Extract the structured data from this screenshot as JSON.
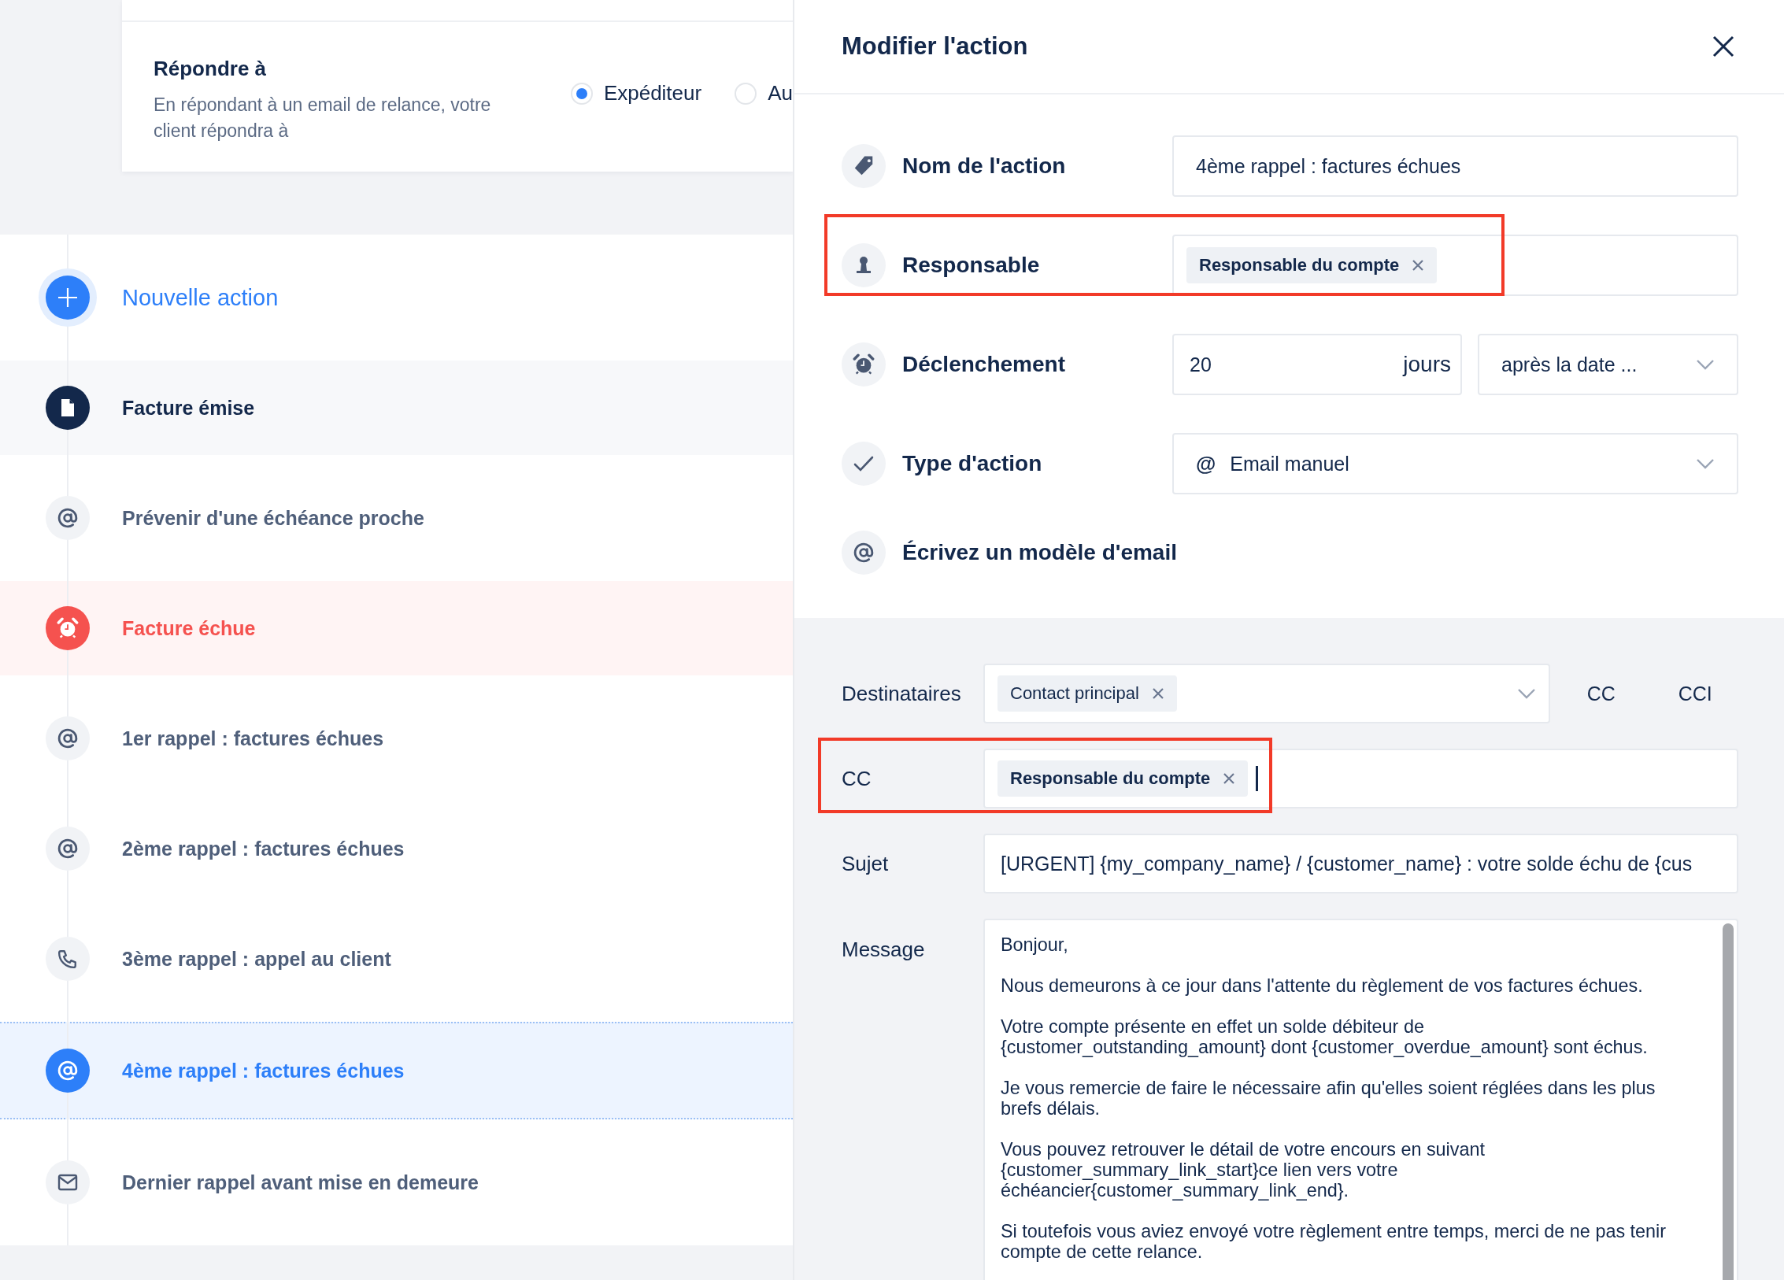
{
  "reply_to": {
    "title": "Répondre à",
    "description": "En répondant à un email de relance, votre client répondra à",
    "options": [
      {
        "label": "Expéditeur",
        "selected": true
      },
      {
        "label": "Au",
        "selected": false
      }
    ]
  },
  "timeline": [
    {
      "kind": "add",
      "label": "Nouvelle action",
      "selected": false
    },
    {
      "kind": "document",
      "color": "#13284b",
      "label": "Facture émise",
      "selected": false
    },
    {
      "kind": "email",
      "label": "Prévenir d'une échéance proche",
      "selected": false
    },
    {
      "kind": "alarm",
      "color": "#f5524f",
      "label": "Facture échue",
      "selected": false
    },
    {
      "kind": "email",
      "label": "1er rappel : factures échues",
      "selected": false
    },
    {
      "kind": "email",
      "label": "2ème rappel : factures échues",
      "selected": false
    },
    {
      "kind": "call",
      "label": "3ème rappel : appel au client",
      "selected": false
    },
    {
      "kind": "email",
      "label": "4ème rappel : factures échues",
      "selected": true
    },
    {
      "kind": "letter",
      "label": "Dernier rappel avant mise en demeure",
      "selected": false
    }
  ],
  "panel": {
    "title": "Modifier l'action",
    "name": {
      "label": "Nom de l'action",
      "value": "4ème rappel : factures échues"
    },
    "owner": {
      "label": "Responsable",
      "highlighted": true,
      "tags": [
        {
          "text": "Responsable du compte",
          "kind": "variable"
        }
      ]
    },
    "trigger": {
      "label": "Déclenchement",
      "days": "20",
      "unit": "jours",
      "reference": "après la date ..."
    },
    "action_type": {
      "label": "Type d'action",
      "symbol": "@",
      "value": "Email manuel"
    },
    "template_heading": "Écrivez un modèle d'email",
    "email": {
      "recipients": {
        "label": "Destinataires",
        "tags": [
          {
            "text": "Contact principal",
            "kind": "contact"
          }
        ]
      },
      "cc_toggle": "CC",
      "cci_toggle": "CCI",
      "cc": {
        "label": "CC",
        "highlighted": true,
        "tags": [
          {
            "text": "Responsable du compte",
            "kind": "variable"
          }
        ]
      },
      "subject": {
        "label": "Sujet",
        "value": "[URGENT] {my_company_name} / {customer_name} : votre solde échu de {cus"
      },
      "message": {
        "label": "Message",
        "paragraphs": [
          "Bonjour,",
          "Nous demeurons à ce jour dans l'attente du règlement de vos factures échues.",
          "Votre compte présente en effet un solde débiteur de {customer_outstanding_amount} dont {customer_overdue_amount} sont échus.",
          "Je vous remercie de faire le nécessaire afin qu'elles soient réglées dans les plus brefs délais.",
          "Vous pouvez retrouver le détail de votre encours en suivant {customer_summary_link_start}ce lien vers votre échéancier{customer_summary_link_end}.",
          "Si toutefois vous aviez envoyé votre règlement entre temps, merci de ne pas tenir compte de cette relance."
        ]
      }
    }
  }
}
